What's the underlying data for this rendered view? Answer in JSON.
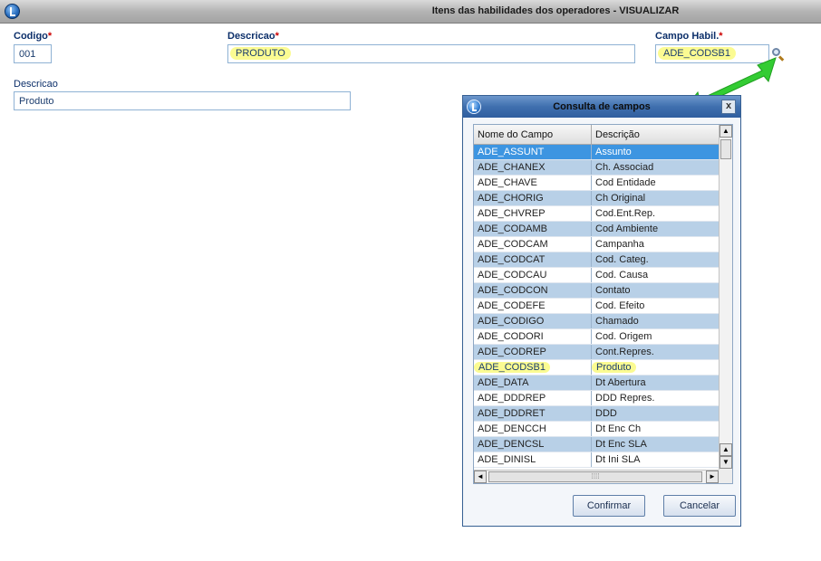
{
  "window": {
    "title": "Itens das habilidades dos operadores - VISUALIZAR"
  },
  "form": {
    "codigo_label": "Codigo",
    "codigo_value": "001",
    "descricao_label": "Descricao",
    "descricao_value": "PRODUTO",
    "campo_label": "Campo Habil.",
    "campo_value": "ADE_CODSB1",
    "required_mark": "*",
    "descricao2_label": "Descricao",
    "descricao2_value": "Produto"
  },
  "dialog": {
    "title": "Consulta de campos",
    "close": "x",
    "columns": [
      "Nome do Campo",
      "Descrição"
    ],
    "rows": [
      {
        "name": "ADE_ASSUNT",
        "desc": "Assunto"
      },
      {
        "name": "ADE_CHANEX",
        "desc": "Ch. Associad"
      },
      {
        "name": "ADE_CHAVE",
        "desc": "Cod Entidade"
      },
      {
        "name": "ADE_CHORIG",
        "desc": "Ch Original"
      },
      {
        "name": "ADE_CHVREP",
        "desc": "Cod.Ent.Rep."
      },
      {
        "name": "ADE_CODAMB",
        "desc": "Cod Ambiente"
      },
      {
        "name": "ADE_CODCAM",
        "desc": "Campanha"
      },
      {
        "name": "ADE_CODCAT",
        "desc": "Cod. Categ."
      },
      {
        "name": "ADE_CODCAU",
        "desc": "Cod. Causa"
      },
      {
        "name": "ADE_CODCON",
        "desc": "Contato"
      },
      {
        "name": "ADE_CODEFE",
        "desc": "Cod. Efeito"
      },
      {
        "name": "ADE_CODIGO",
        "desc": "Chamado"
      },
      {
        "name": "ADE_CODORI",
        "desc": "Cod. Origem"
      },
      {
        "name": "ADE_CODREP",
        "desc": "Cont.Repres."
      },
      {
        "name": "ADE_CODSB1",
        "desc": "Produto"
      },
      {
        "name": "ADE_DATA",
        "desc": "Dt Abertura"
      },
      {
        "name": "ADE_DDDREP",
        "desc": "DDD Repres."
      },
      {
        "name": "ADE_DDDRET",
        "desc": "DDD"
      },
      {
        "name": "ADE_DENCCH",
        "desc": "Dt Enc Ch"
      },
      {
        "name": "ADE_DENCSL",
        "desc": "Dt Enc SLA"
      },
      {
        "name": "ADE_DINISL",
        "desc": "Dt Ini SLA"
      }
    ],
    "selected_index": 0,
    "highlight_index": 14,
    "confirm_label": "Confirmar",
    "cancel_label": "Cancelar",
    "scroll_up": "▲",
    "scroll_down": "▼",
    "scroll_left": "◄",
    "scroll_right": "►",
    "grip": "⁞⁞⁞⁞"
  },
  "colors": {
    "selected_row": "#3d95e1",
    "even_row": "#b8d0e7",
    "highlight": "#fbfb92",
    "arrow": "#33cc33"
  }
}
